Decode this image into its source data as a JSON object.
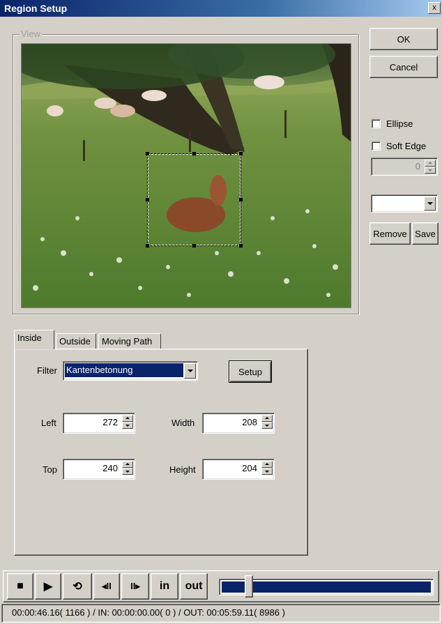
{
  "window": {
    "title": "Region Setup",
    "close_glyph": "x"
  },
  "view": {
    "legend": "View"
  },
  "buttons": {
    "ok": "OK",
    "cancel": "Cancel",
    "remove": "Remove",
    "save": "Save",
    "setup": "Setup"
  },
  "options": {
    "ellipse_label": "Ellipse",
    "ellipse_checked": false,
    "soft_edge_label": "Soft Edge",
    "soft_edge_checked": false,
    "soft_edge_value": "0",
    "preset_value": ""
  },
  "tabs": [
    {
      "label": "Inside",
      "active": true
    },
    {
      "label": "Outside",
      "active": false
    },
    {
      "label": "Moving Path",
      "active": false
    }
  ],
  "form": {
    "filter_label": "Filter",
    "filter_value": "Kantenbetonung",
    "left_label": "Left",
    "left_value": "272",
    "width_label": "Width",
    "width_value": "208",
    "top_label": "Top",
    "top_value": "240",
    "height_label": "Height",
    "height_value": "204"
  },
  "transport": {
    "stop_icon": "■",
    "play_icon": "▶",
    "loop_icon": "⟲",
    "prev_frame_icon": "◂II",
    "next_frame_icon": "II▸",
    "in_label": "in",
    "out_label": "out",
    "position": 0.08
  },
  "status": {
    "text": "00:00:46.16( 1166 ) / IN: 00:00:00.00( 0 ) / OUT: 00:05:59.11( 8986 )"
  },
  "colors": {
    "title_bar": "#0a246a",
    "selection": "#0a246a",
    "face": "#d4d0c8",
    "slider_track": "#0a246a"
  }
}
